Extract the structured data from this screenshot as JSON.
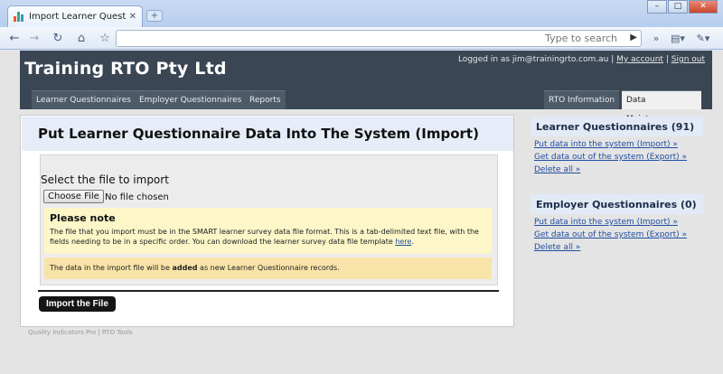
{
  "browser": {
    "tab_title": "Import Learner Questionna…",
    "tab_close": "✕",
    "new_tab": "+",
    "window_buttons": [
      "–",
      "□",
      "✕"
    ],
    "omnibox_placeholder": "Type to search",
    "toolbar_icons": [
      "back-icon",
      "forward-icon",
      "reload-icon",
      "home-icon",
      "star-icon",
      "go-icon",
      "overflow-icon",
      "page-menu-icon",
      "wrench-icon"
    ]
  },
  "header": {
    "logo": "Training RTO Pty Ltd",
    "logged_in_text": "Logged in as jim@trainingrto.com.au",
    "sep1": "|",
    "my_account": "My account",
    "sep2": "|",
    "sign_out": "Sign out"
  },
  "nav": {
    "left_tabs": [
      "Learner Questionnaires",
      "Employer Questionnaires",
      "Reports"
    ],
    "right_tabs": [
      "RTO Information",
      "Data Maintenance"
    ],
    "active": "Data Maintenance"
  },
  "main": {
    "title": "Put Learner Questionnaire Data Into The System (Import)",
    "select_heading": "Select the file to import",
    "choose_file": "Choose File",
    "no_file": "No file chosen",
    "note_heading": "Please note",
    "note_text": "The file that you import must be in the SMART learner survey data file format. This is a tab-delimited text file, with the fields needing to be in a specific order. You can download the learner survey data file template ",
    "note_link": "here",
    "note_end": ".",
    "added_pre": "The data in the import file will be ",
    "added_bold": "added",
    "added_post": " as new Learner Questionnaire records.",
    "import_button": "Import the File"
  },
  "footer": "Quality Indicators Pro | RTO Tools",
  "sidebar": [
    {
      "title": "Learner Questionnaires (91)",
      "links": [
        "Put data into the system (Import) »",
        "Get data out of the system (Export) »",
        "Delete all »"
      ]
    },
    {
      "title": "Employer Questionnaires (0)",
      "links": [
        "Put data into the system (Import) »",
        "Get data out of the system (Export) »",
        "Delete all »"
      ]
    }
  ],
  "colors": {
    "header_bg": "#3a4653",
    "title_bg": "#e6edf8",
    "note_bg": "#fcf6c8",
    "added_bg": "#f8e4a8",
    "link": "#1f4ea3"
  }
}
